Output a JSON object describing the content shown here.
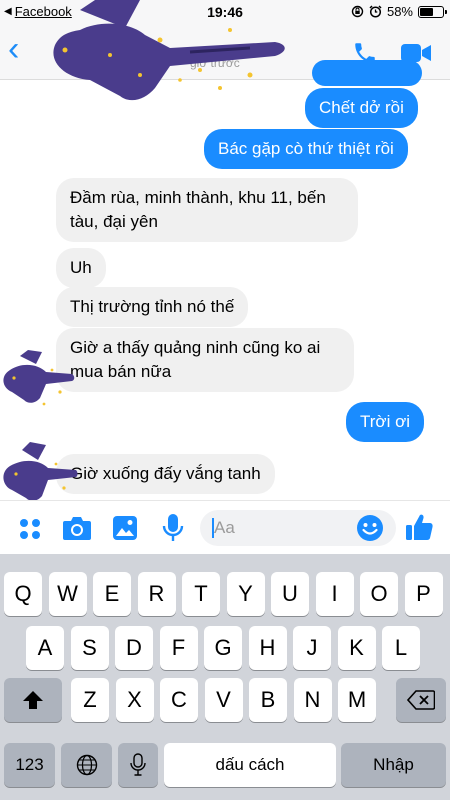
{
  "status_bar": {
    "back_app": "Facebook",
    "time": "19:46",
    "battery": "58%",
    "battery_level": 0.58
  },
  "header": {
    "subtitle": "giờ trước"
  },
  "messages": [
    {
      "sender": "me",
      "text": "Chết dở rồi"
    },
    {
      "sender": "me",
      "text": "Bác gặp cò thứ thiệt rồi"
    },
    {
      "sender": "other",
      "line1": "Đầm rùa, minh thành, khu 11, bến",
      "line2": "tàu, đại yên"
    },
    {
      "sender": "other",
      "text": "Uh"
    },
    {
      "sender": "other",
      "text": "Thị trường tỉnh nó thế"
    },
    {
      "sender": "other",
      "line1": "Giờ a thấy quảng ninh cũng ko ai",
      "line2": "mua bán nữa"
    },
    {
      "sender": "me",
      "text": "Trời ơi"
    },
    {
      "sender": "other",
      "text": "Giờ xuống đấy vắng tanh"
    }
  ],
  "composer": {
    "placeholder": "Aa"
  },
  "keyboard": {
    "row1": [
      "Q",
      "W",
      "E",
      "R",
      "T",
      "Y",
      "U",
      "I",
      "O",
      "P"
    ],
    "row2": [
      "A",
      "S",
      "D",
      "F",
      "G",
      "H",
      "J",
      "K",
      "L"
    ],
    "row3": [
      "Z",
      "X",
      "C",
      "V",
      "B",
      "N",
      "M"
    ],
    "numbers_key": "123",
    "space_key": "dấu cách",
    "return_key": "Nhập"
  },
  "colors": {
    "accent": "#1a8cff",
    "incoming_bubble": "#f0f0f0",
    "keyboard_bg": "#d1d4da",
    "sticker_purple": "#4a3c8c"
  }
}
